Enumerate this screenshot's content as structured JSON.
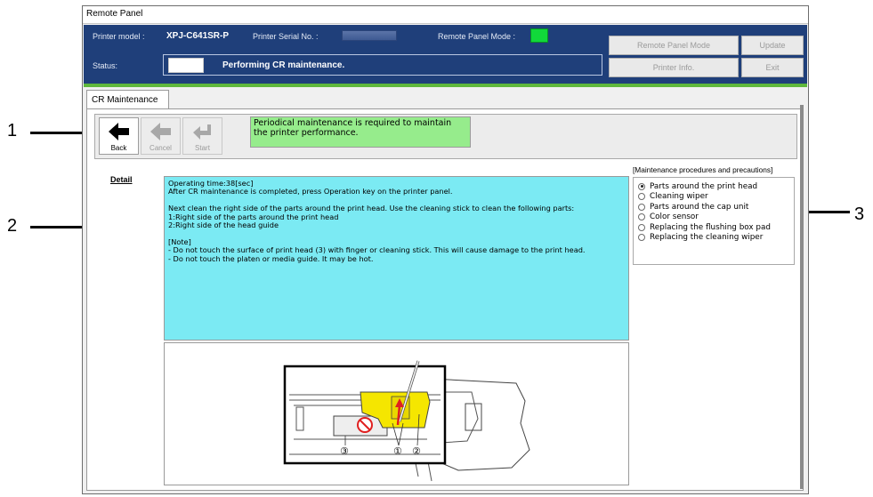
{
  "window": {
    "title": "Remote Panel"
  },
  "header": {
    "printer_model_label": "Printer model :",
    "printer_model_value": "XPJ-C641SR-P",
    "serial_label": "Printer Serial No. :",
    "remote_mode_label": "Remote Panel Mode :",
    "remote_mode_color": "#11d83a",
    "status_label": "Status:",
    "status_text": "Performing CR maintenance.",
    "buttons": {
      "remote_panel_mode": "Remote Panel Mode",
      "update": "Update",
      "printer_info": "Printer Info.",
      "exit": "Exit"
    }
  },
  "tab": {
    "label": "CR Maintenance"
  },
  "toolbar": {
    "back": "Back",
    "cancel": "Cancel",
    "start": "Start",
    "message": "Periodical maintenance is required to maintain the printer performance."
  },
  "detail": {
    "label": "Detail",
    "lines": [
      "Operating time:38[sec]",
      "After CR maintenance is completed, press Operation key on the printer panel.",
      "",
      "Next clean the right side of the parts around the print head. Use the cleaning stick to clean the following parts:",
      "1:Right side of the parts around the print head",
      "2:Right side of the head guide",
      "",
      "[Note]",
      "- Do not touch the surface of print head (3) with finger or cleaning stick. This will cause damage to the print head.",
      "- Do not touch the platen or media guide. It may be hot."
    ]
  },
  "procedures": {
    "header": "[Maintenance procedures and precautions]",
    "items": [
      {
        "label": "Parts around the print head",
        "selected": true
      },
      {
        "label": "Cleaning wiper",
        "selected": false
      },
      {
        "label": "Parts around the cap unit",
        "selected": false
      },
      {
        "label": "Color sensor",
        "selected": false
      },
      {
        "label": "Replacing the flushing box pad",
        "selected": false
      },
      {
        "label": "Replacing the cleaning wiper",
        "selected": false
      }
    ]
  },
  "illustration": {
    "part_labels": [
      "③",
      "①",
      "②"
    ],
    "highlight_color": "#f5e600"
  },
  "callouts": [
    "1",
    "2",
    "3"
  ]
}
